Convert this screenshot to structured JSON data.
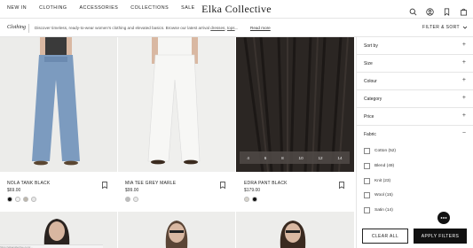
{
  "nav": {
    "links": [
      "NEW IN",
      "CLOTHING",
      "ACCESSORIES",
      "COLLECTIONS",
      "SALE"
    ],
    "brand": "Elka Collective",
    "cart_count": "0",
    "icons": [
      "search-icon",
      "account-icon",
      "bookmark-icon",
      "bag-icon"
    ]
  },
  "subbar": {
    "category": "Clothing",
    "description": "Discover timeless, ready-to-wear women's clothing and elevated basics. Browse our latest arrival",
    "desc_links": [
      "dresses",
      "tops"
    ],
    "desc_ellipsis": "...",
    "read_more": "Read more",
    "filter_sort": "FILTER & SORT"
  },
  "products": [
    {
      "name": "NOLA TANK BLACK",
      "price": "$69.00",
      "swatches": [
        "#111111",
        "#f3f3f3",
        "#bdb7ac",
        "#e7e7e7"
      ]
    },
    {
      "name": "MIA TEE GREY MARLE",
      "price": "$99.00",
      "swatches": [
        "#bdbdbd",
        "#e9e9e9"
      ]
    },
    {
      "name": "EDRA PANT BLACK",
      "price": "$179.00",
      "swatches": [
        "#d8d4cc",
        "#111111"
      ],
      "sizes": [
        "4",
        "6",
        "8",
        "10",
        "12",
        "14"
      ]
    }
  ],
  "filter_panel": {
    "facets": [
      "Sort by",
      "Size",
      "Colour",
      "Category",
      "Price",
      "Fabric"
    ],
    "expanded": "Fabric",
    "fabric_options": [
      "Cotton (52)",
      "Blend (49)",
      "Knit (23)",
      "Wool (15)",
      "Satin (14)"
    ],
    "clear_all": "CLEAR ALL",
    "apply": "APPLY FILTERS"
  },
  "status_url": "https://elkacollective.com/..."
}
